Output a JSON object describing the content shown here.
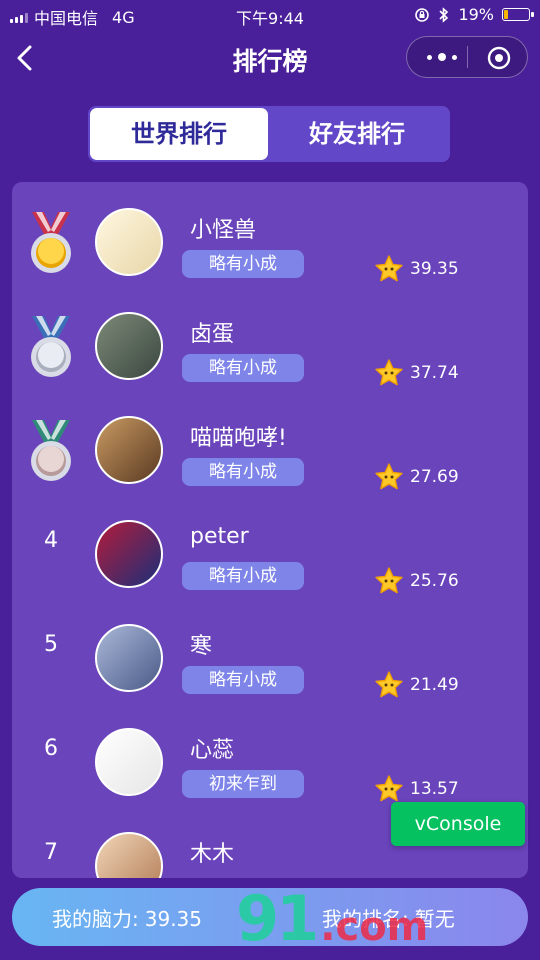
{
  "status_bar": {
    "carrier": "中国电信",
    "network": "4G",
    "time": "下午9:44",
    "battery": "19%",
    "battery_level": 0.19,
    "battery_color": "#f7b500"
  },
  "nav": {
    "title": "排行榜"
  },
  "tabs": [
    {
      "label": "世界排行",
      "active": true
    },
    {
      "label": "好友排行",
      "active": false
    }
  ],
  "leaderboard": [
    {
      "rank": "1",
      "medal": "gold",
      "name": "小怪兽",
      "title": "略有小成",
      "score": "39.35"
    },
    {
      "rank": "2",
      "medal": "silver",
      "name": "卤蛋",
      "title": "略有小成",
      "score": "37.74"
    },
    {
      "rank": "3",
      "medal": "bronze",
      "name": "喵喵咆哮!",
      "title": "略有小成",
      "score": "27.69"
    },
    {
      "rank": "4",
      "medal": "",
      "name": "peter",
      "title": "略有小成",
      "score": "25.76"
    },
    {
      "rank": "5",
      "medal": "",
      "name": "寒",
      "title": "略有小成",
      "score": "21.49"
    },
    {
      "rank": "6",
      "medal": "",
      "name": "心蕊",
      "title": "初来乍到",
      "score": "13.57"
    },
    {
      "rank": "7",
      "medal": "",
      "name": "木木",
      "title": "",
      "score": ""
    }
  ],
  "vconsole": {
    "label": "vConsole"
  },
  "footer": {
    "brain_label": "我的脑力:",
    "brain_value": "39.35",
    "rank_label": "我的排名:",
    "rank_value": "暂无"
  },
  "watermark": {
    "text": "91",
    "suffix": ".com"
  }
}
